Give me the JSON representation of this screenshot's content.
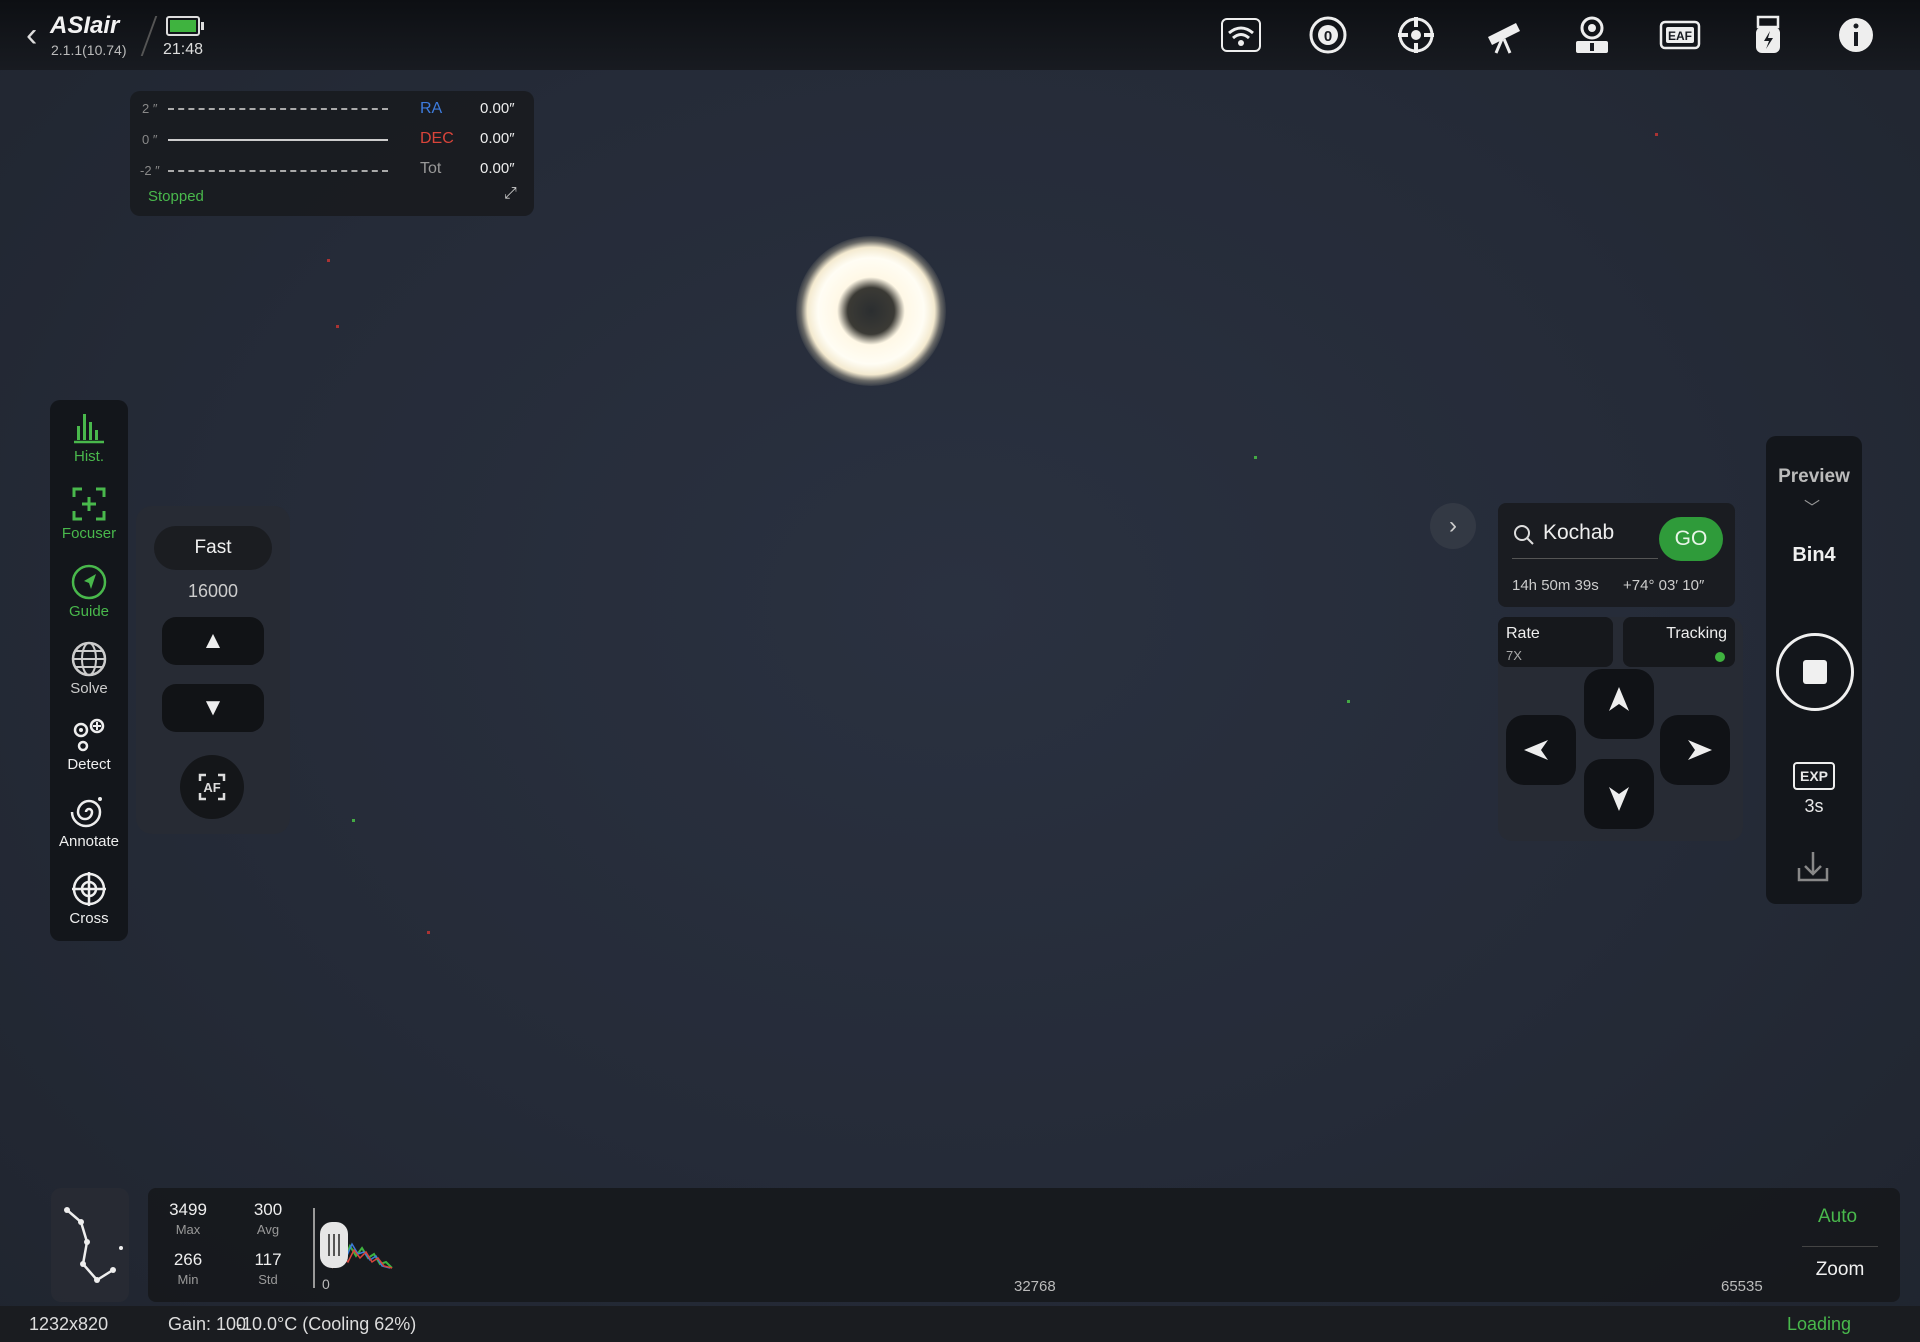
{
  "app": {
    "logo": "ASIair",
    "version": "2.1.1(10.74)",
    "time": "21:48",
    "battery_color": "#3fb33f"
  },
  "topbar_icons": [
    "wifi-icon",
    "filter-wheel-icon",
    "camera-cooler-icon",
    "telescope-icon",
    "guide-camera-icon",
    "eaf-icon",
    "usb-power-icon",
    "info-icon"
  ],
  "guide": {
    "axis_top": "2 ″",
    "axis_mid": "0 ″",
    "axis_bottom": "-2 ″",
    "ra_label": "RA",
    "ra_value": "0.00″",
    "dec_label": "DEC",
    "dec_value": "0.00″",
    "tot_label": "Tot",
    "tot_value": "0.00″",
    "status": "Stopped",
    "ra_color": "#3d7bdc",
    "dec_color": "#d9443a"
  },
  "tools": [
    {
      "label": "Hist.",
      "icon": "histogram-icon",
      "active": true
    },
    {
      "label": "Focuser",
      "icon": "focuser-icon",
      "active": true
    },
    {
      "label": "Guide",
      "icon": "guide-icon",
      "active": true
    },
    {
      "label": "Solve",
      "icon": "globe-icon",
      "active": false
    },
    {
      "label": "Detect",
      "icon": "detect-icon",
      "active": false
    },
    {
      "label": "Annotate",
      "icon": "annotate-icon",
      "active": false
    },
    {
      "label": "Cross",
      "icon": "crosshair-icon",
      "active": false
    }
  ],
  "focuser": {
    "speed": "Fast",
    "position": "16000",
    "af_label": "AF"
  },
  "goto": {
    "target": "Kochab",
    "go_label": "GO",
    "ra": "14h 50m 39s",
    "dec": "+74° 03′ 10″"
  },
  "mount": {
    "rate_label": "Rate",
    "rate_value": "7X",
    "tracking_label": "Tracking",
    "tracking_on": true
  },
  "capture": {
    "mode": "Preview",
    "bin": "Bin4",
    "exp_label": "EXP",
    "exposure": "3s"
  },
  "histogram": {
    "max_value": "3499",
    "max_label": "Max",
    "avg_value": "300",
    "avg_label": "Avg",
    "min_value": "266",
    "min_label": "Min",
    "std_value": "117",
    "std_label": "Std",
    "scale_min": "0",
    "scale_mid": "32768",
    "scale_max": "65535",
    "auto_label": "Auto",
    "zoom_label": "Zoom"
  },
  "status": {
    "resolution": "1232x820",
    "gain": "Gain: 100",
    "temperature": "-10.0°C (Cooling 62%)",
    "state": "Loading"
  }
}
